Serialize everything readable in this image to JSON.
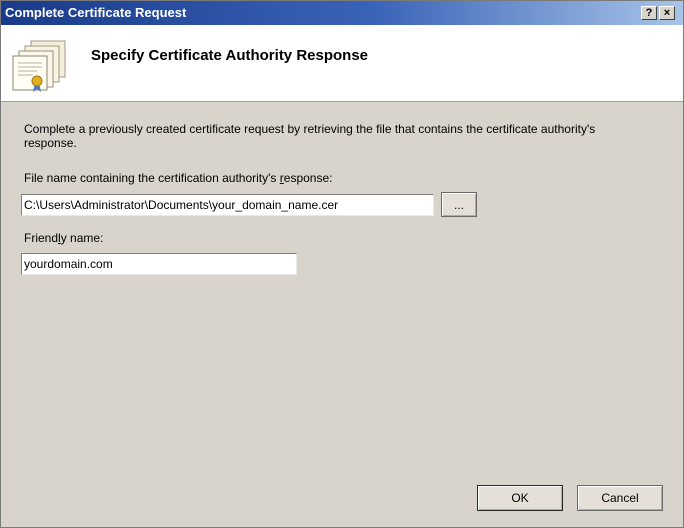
{
  "window": {
    "title": "Complete Certificate Request",
    "help_button": "?",
    "close_button": "×"
  },
  "header": {
    "title": "Specify Certificate Authority Response",
    "icon": "certificates-icon"
  },
  "body": {
    "description": "Complete a previously created certificate request by retrieving the file that contains the certificate authority's response.",
    "file_label_pre": "File name containing the certification authority's ",
    "file_label_accel": "r",
    "file_label_post": "esponse:",
    "file_value": "C:\\Users\\Administrator\\Documents\\your_domain_name.cer",
    "browse_label": "...",
    "friendly_label_pre": "Friend",
    "friendly_label_accel": "l",
    "friendly_label_post": "y name:",
    "friendly_value": "yourdomain.com"
  },
  "buttons": {
    "ok": "OK",
    "cancel": "Cancel"
  },
  "colors": {
    "titlebar_start": "#1a3a8a",
    "titlebar_end": "#a8c4e8",
    "dialog_bg": "#d8d4cc",
    "header_bg": "#ffffff"
  }
}
